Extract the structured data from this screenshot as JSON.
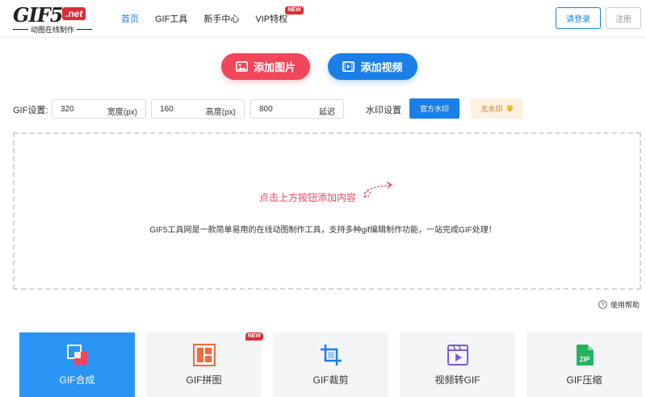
{
  "header": {
    "logo": {
      "main": "GIF5",
      "badge": ".net",
      "tagline": "动图在线制作"
    },
    "nav": [
      {
        "label": "首页",
        "active": true
      },
      {
        "label": "GIF工具",
        "active": false
      },
      {
        "label": "新手中心",
        "active": false
      },
      {
        "label": "VIP特权",
        "active": false,
        "badge": "NEW"
      }
    ],
    "login_label": "请登录",
    "register_label": "注册"
  },
  "actions": {
    "add_image_label": "添加图片",
    "add_video_label": "添加视频"
  },
  "settings": {
    "label": "GIF设置:",
    "width": {
      "value": "320",
      "unit": "宽度(px)"
    },
    "height": {
      "value": "160",
      "unit": "高度(px)"
    },
    "delay": {
      "value": "800",
      "unit": "延迟"
    },
    "watermark_label": "水印设置",
    "official_wm_label": "官方水印",
    "no_wm_label": "无水印"
  },
  "dropzone": {
    "hint": "点击上方按钮添加内容",
    "description": "GIF5工具网是一款简单易用的在线动图制作工具，支持多种gif编辑制作功能，一站完成GIF处理！"
  },
  "help_label": "使用帮助",
  "tools": [
    {
      "label": "GIF合成",
      "icon": "gif-compose-icon",
      "active": true
    },
    {
      "label": "GIF拼图",
      "icon": "gif-collage-icon",
      "active": false,
      "badge": "NEW"
    },
    {
      "label": "GIF裁剪",
      "icon": "crop-icon",
      "active": false
    },
    {
      "label": "视频转GIF",
      "icon": "video-to-gif-icon",
      "active": false
    },
    {
      "label": "GIF压缩",
      "icon": "zip-icon",
      "active": false
    }
  ],
  "colors": {
    "primary": "#1a7fe6",
    "accent": "#f0475b",
    "active_tool": "#2b95f5"
  }
}
